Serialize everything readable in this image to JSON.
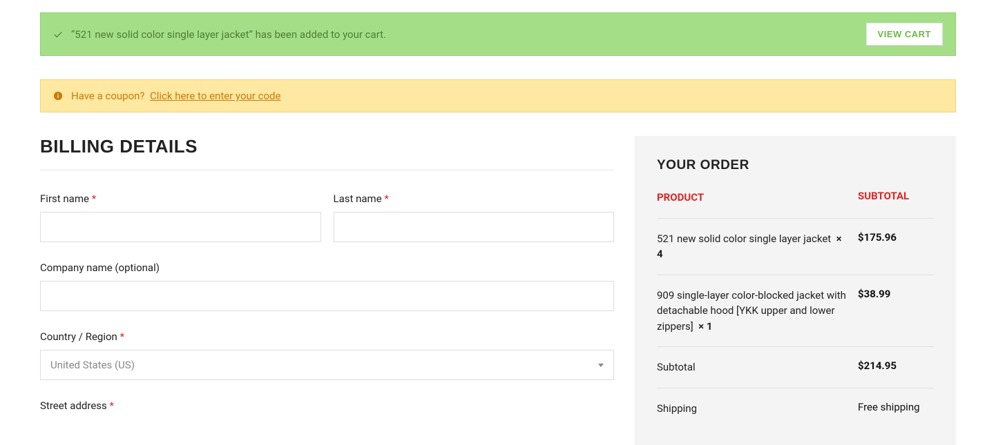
{
  "alerts": {
    "success": {
      "message": "“521 new solid color single layer jacket” has been added to your cart.",
      "button": "VIEW CART"
    },
    "coupon": {
      "prompt": "Have a coupon?",
      "link": "Click here to enter your code"
    }
  },
  "billing": {
    "heading": "BILLING DETAILS",
    "first_name_label": "First name",
    "last_name_label": "Last name",
    "company_label": "Company name (optional)",
    "country_label": "Country / Region",
    "country_value": "United States (US)",
    "street_label": "Street address",
    "required_mark": "*"
  },
  "order": {
    "heading": "YOUR ORDER",
    "col_product": "PRODUCT",
    "col_subtotal": "SUBTOTAL",
    "items": [
      {
        "name": "521 new solid color single layer jacket",
        "qty": "× 4",
        "subtotal": "$175.96"
      },
      {
        "name": "909 single-layer color-blocked jacket with detachable hood [YKK upper and lower zippers]",
        "qty": "× 1",
        "subtotal": "$38.99"
      }
    ],
    "subtotal_label": "Subtotal",
    "subtotal_value": "$214.95",
    "shipping_label": "Shipping",
    "shipping_value": "Free shipping"
  }
}
